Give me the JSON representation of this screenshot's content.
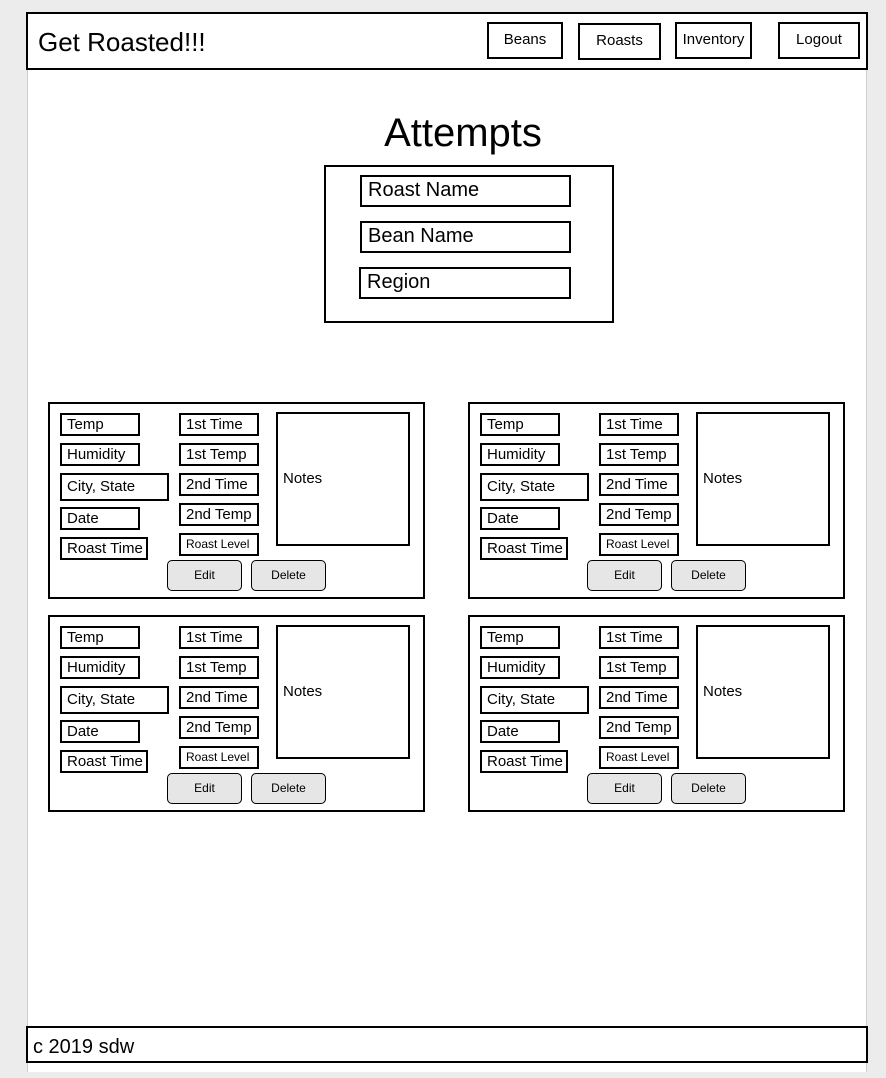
{
  "header": {
    "brand": "Get Roasted!!!",
    "nav": [
      "Beans",
      "Roasts",
      "Inventory",
      "Logout"
    ]
  },
  "page": {
    "title": "Attempts"
  },
  "search": {
    "roast_name": "Roast Name",
    "bean_name": "Bean Name",
    "region": "Region"
  },
  "card_labels": {
    "temp": "Temp",
    "humidity": "Humidity",
    "city_state": "City, State",
    "date": "Date",
    "roast_time": "Roast Time",
    "first_time": "1st Time",
    "first_temp": "1st Temp",
    "second_time": "2nd Time",
    "second_temp": "2nd Temp",
    "roast_level": "Roast Level",
    "notes": "Notes",
    "edit": "Edit",
    "delete": "Delete"
  },
  "footer": {
    "copyright": "c 2019 sdw"
  }
}
